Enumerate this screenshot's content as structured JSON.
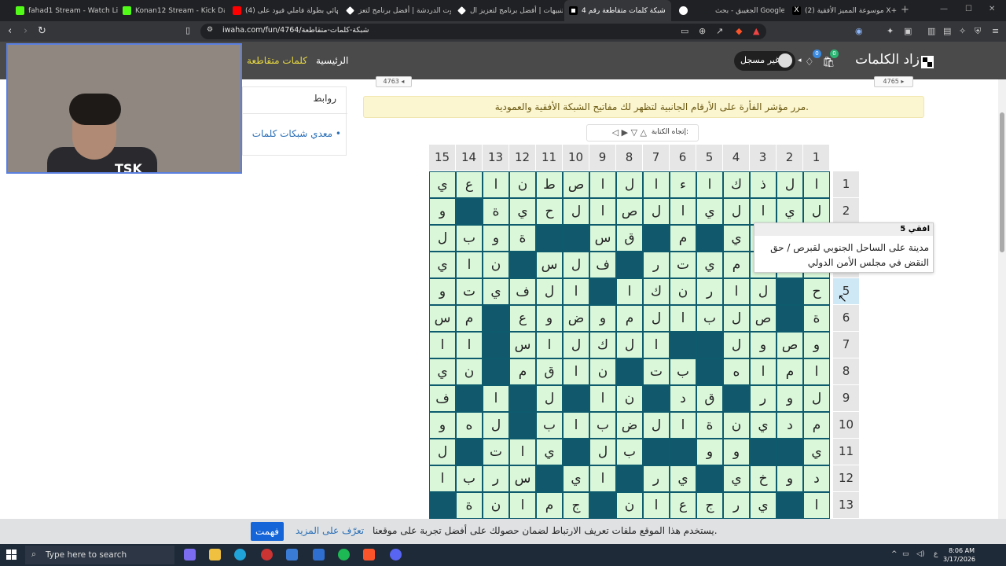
{
  "browser": {
    "tabs": [
      {
        "title": "fahad1 Stream - Watch Live on",
        "color": "#53fc18"
      },
      {
        "title": "Konan12 Stream - Kick Dashbo",
        "color": "#53fc18"
      },
      {
        "title": "(4) نهائي بطولة فاملي فيود على",
        "color": "#ff0000"
      },
      {
        "title": "بوت الدردشة | أفضل برنامج لتعز",
        "color": "#ffffff"
      },
      {
        "title": "التنبيهات | أفضل برنامج لتعزيز ال",
        "color": "#ffffff"
      },
      {
        "title": "شبكة كلمات متقاطعة رقم 4",
        "color": "#ffffff"
      },
      {
        "title": "الجغيبق - بحث Google",
        "color": "#ffffff"
      },
      {
        "title": "(2) موسوعة المميز الأفقية X+",
        "color": "#ffffff"
      }
    ],
    "url": "iwaha.com/fun/4764/شبكة-كلمات-متقاطعة"
  },
  "site": {
    "logo": "زاد الكلمات",
    "user_label": "غير مسجل",
    "cart_count": "0",
    "diamond_count": "0",
    "nav_home": "الرئيسية",
    "nav_crosswords": "كلمات متقاطعة",
    "prev_puzzle": "4763",
    "next_puzzle": "4765"
  },
  "sidebar": {
    "title": "روابط",
    "link": "معدي شبكات كلمات"
  },
  "notice": "مرر مؤشر الفأرة على الأرقام الجانبية لتظهر لك مفاتيح الشبكة الأفقية والعمودية.",
  "direction": {
    "label": "إتجاه الكتابة:",
    "arrows": "◁ ▶ ▽ △"
  },
  "grid": {
    "col_numbers": [
      "1",
      "2",
      "3",
      "4",
      "5",
      "6",
      "7",
      "8",
      "9",
      "10",
      "11",
      "12",
      "13",
      "14",
      "15"
    ],
    "row_numbers": [
      "1",
      "2",
      "3",
      "4",
      "5",
      "6",
      "7",
      "8",
      "9",
      "10",
      "11",
      "12",
      "13"
    ],
    "highlight_row": 5,
    "rows": [
      [
        "ا",
        "ل",
        "ذ",
        "ك",
        "ا",
        "ء",
        "ا",
        "ل",
        "ا",
        "ص",
        "ط",
        "ن",
        "ا",
        "ع",
        "ي"
      ],
      [
        "ل",
        "ي",
        "ا",
        "ل",
        "ي",
        "ا",
        "ل",
        "ص",
        "ا",
        "ل",
        "ح",
        "ي",
        "ة",
        "#",
        "و"
      ],
      [
        "",
        "",
        "",
        "ي",
        "#",
        "م",
        "#",
        "ق",
        "س",
        "#",
        "#",
        "ة",
        "و",
        "ب",
        "ل"
      ],
      [
        "",
        "",
        "",
        "م",
        "ي",
        "ت",
        "ر",
        "#",
        "ف",
        "ل",
        "س",
        "#",
        "ن",
        "ا",
        "ي"
      ],
      [
        "ح",
        "#",
        "ل",
        "ا",
        "ر",
        "ن",
        "ك",
        "ا",
        "#",
        "ا",
        "ل",
        "ف",
        "ي",
        "ت",
        "و"
      ],
      [
        "ة",
        "#",
        "ص",
        "ل",
        "ب",
        "ا",
        "ل",
        "م",
        "و",
        "ض",
        "و",
        "ع",
        "#",
        "م",
        "س"
      ],
      [
        "و",
        "ص",
        "و",
        "ل",
        "#",
        "#",
        "ا",
        "ل",
        "ك",
        "ل",
        "ا",
        "س",
        "#",
        "ا",
        "ا"
      ],
      [
        "ا",
        "م",
        "ا",
        "ه",
        "#",
        "ب",
        "ت",
        "#",
        "ن",
        "ا",
        "ق",
        "م",
        "#",
        "ن",
        "ي"
      ],
      [
        "ل",
        "و",
        "ر",
        "#",
        "ق",
        "د",
        "#",
        "ن",
        "ا",
        "#",
        "ل",
        "#",
        "ا",
        "#",
        "ف"
      ],
      [
        "م",
        "د",
        "ي",
        "ن",
        "ة",
        "ا",
        "ل",
        "ض",
        "ب",
        "ا",
        "ب",
        "#",
        "ل",
        "ه",
        "و"
      ],
      [
        "ي",
        "#",
        "#",
        "و",
        "و",
        "#",
        "#",
        "ب",
        "ل",
        "#",
        "ي",
        "ا",
        "ت",
        "#",
        "ل"
      ],
      [
        "د",
        "و",
        "خ",
        "ي",
        "#",
        "ي",
        "ر",
        "#",
        "ا",
        "ي",
        "#",
        "س",
        "ر",
        "ب",
        "ا"
      ],
      [
        "ا",
        "#",
        "ي",
        "ر",
        "ج",
        "ع",
        "ا",
        "ن",
        "#",
        "ج",
        "م",
        "ا",
        "ن",
        "ة",
        "#"
      ]
    ]
  },
  "tooltip": {
    "title": "افقي 5",
    "text": "مدينة على الساحل الجنوبي لقبرص / حق النقض في مجلس الأمن الدولي"
  },
  "cookie": {
    "message": "يستخدم هذا الموقع ملفات تعريف الارتباط لضمان حصولك على أفضل تجربة على موقعنا.",
    "more": "تعرّف على المزيد",
    "button": "فهمت"
  },
  "taskbar": {
    "search_placeholder": "Type here to search",
    "time": "8:06 AM",
    "date": "3/17/2026",
    "lang": "ع"
  }
}
